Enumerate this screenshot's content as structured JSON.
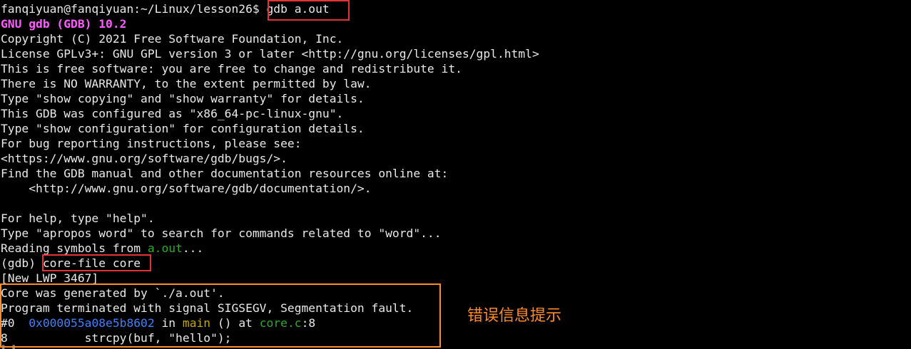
{
  "terminal": {
    "prompt": "fanqiyuan@fanqiyuan:~/Linux/lesson26$ ",
    "command": "gdb a.out",
    "banner": "GNU gdb (GDB) 10.2",
    "lines": [
      "Copyright (C) 2021 Free Software Foundation, Inc.",
      "License GPLv3+: GNU GPL version 3 or later <http://gnu.org/licenses/gpl.html>",
      "This is free software: you are free to change and redistribute it.",
      "There is NO WARRANTY, to the extent permitted by law.",
      "Type \"show copying\" and \"show warranty\" for details.",
      "This GDB was configured as \"x86_64-pc-linux-gnu\".",
      "Type \"show configuration\" for configuration details.",
      "For bug reporting instructions, please see:",
      "<https://www.gnu.org/software/gdb/bugs/>.",
      "Find the GDB manual and other documentation resources online at:",
      "    <http://www.gnu.org/software/gdb/documentation/>.",
      "",
      "For help, type \"help\".",
      "Type \"apropos word\" to search for commands related to \"word\"..."
    ],
    "reading_prefix": "Reading symbols from ",
    "reading_file": "a.out",
    "reading_suffix": "...",
    "gdb_prompt": "(gdb) ",
    "gdb_command": "core-file core",
    "new_lwp": "[New LWP 3467]",
    "core_generated": "Core was generated by `./a.out'.",
    "terminated": "Program terminated with signal SIGSEGV, Segmentation fault.",
    "frame_prefix": "#0  ",
    "frame_addr": "0x000055a08e5b8602",
    "frame_in": " in ",
    "frame_func": "main",
    "frame_mid": " () at ",
    "frame_file": "core.c",
    "frame_line": ":8",
    "source_line": "8\t    strcpy(buf, \"hello\");"
  },
  "annotation": {
    "text": "错误信息提示"
  },
  "colors": {
    "background": "#000000",
    "foreground": "#e8e8e8",
    "banner": "#ff5cff",
    "filename_green": "#2fa82f",
    "address_blue": "#3f7fff",
    "function_yellow": "#c8a800",
    "highlight_red": "#e53333",
    "highlight_orange": "#ff8a2a"
  }
}
